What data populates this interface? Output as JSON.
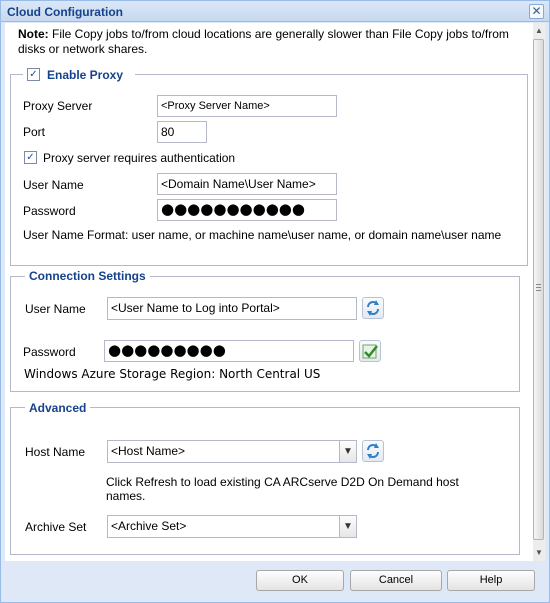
{
  "window": {
    "title": "Cloud Configuration",
    "close_glyph": "✕"
  },
  "note": {
    "prefix": "Note:",
    "text": " File Copy jobs to/from cloud locations are generally slower than File Copy jobs to/from disks or network shares."
  },
  "proxy": {
    "legend": "Enable Proxy",
    "enabled": true,
    "server_label": "Proxy Server",
    "server_value": "<Proxy Server Name>",
    "port_label": "Port",
    "port_value": "80",
    "auth_label": "Proxy server requires authentication",
    "auth_enabled": true,
    "username_label": "User Name",
    "username_value": "<Domain Name\\User Name>",
    "password_label": "Password",
    "password_value": "●●●●●●●●●●●",
    "format_hint": "User Name Format: user name, or machine name\\user name, or domain name\\user name"
  },
  "connection": {
    "legend": "Connection Settings",
    "username_label": "User Name",
    "username_value": "<User Name to Log into Portal>",
    "password_label": "Password",
    "password_value": "●●●●●●●●●",
    "region_text": "Windows Azure Storage Region: North Central US"
  },
  "advanced": {
    "legend": "Advanced",
    "host_label": "Host Name",
    "host_value": "<Host Name>",
    "host_hint": "Click Refresh to load existing CA ARCserve D2D On Demand host names.",
    "archive_label": "Archive Set",
    "archive_value": "<Archive Set>"
  },
  "buttons": {
    "ok": "OK",
    "cancel": "Cancel",
    "help": "Help"
  },
  "icons": {
    "check": "✓",
    "arrow_down": "▼",
    "arrow_up": "▲",
    "refresh": "refresh-icon",
    "verify": "verify-icon"
  }
}
